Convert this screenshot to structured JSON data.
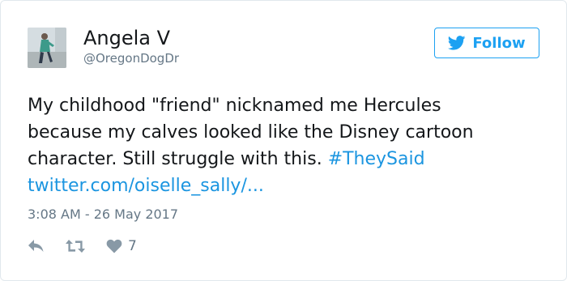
{
  "user": {
    "name": "Angela V",
    "handle": "@OregonDogDr",
    "avatar_icon": "profile-photo"
  },
  "follow_button": {
    "label": "Follow",
    "icon": "twitter-bird-icon",
    "color": "#1da1f2"
  },
  "tweet": {
    "line1": "My childhood \"friend\" nicknamed me Hercules",
    "line2": "because my calves looked like the Disney cartoon",
    "line3_text": "character. Still struggle with this. ",
    "hashtag": "#TheySaid",
    "link": "twitter.com/oiselle_sally/...",
    "link_color": "#1b95e0"
  },
  "timestamp": "3:08 AM - 26 May 2017",
  "actions": {
    "reply_icon": "reply-icon",
    "retweet_icon": "retweet-icon",
    "like_icon": "heart-icon",
    "like_count": "7"
  }
}
